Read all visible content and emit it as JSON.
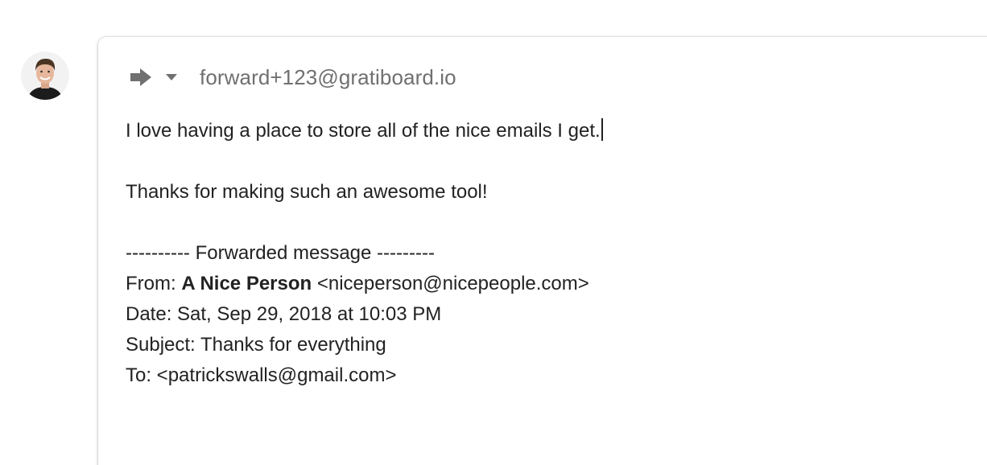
{
  "compose": {
    "recipient": "forward+123@gratiboard.io",
    "body": {
      "line1": "I love having a place to store all of the nice emails I get.",
      "line2": "Thanks for making such an awesome tool!",
      "forwarded_header": "---------- Forwarded message ---------",
      "from_label": "From:",
      "from_name": "A Nice Person",
      "from_email": "<niceperson@nicepeople.com>",
      "date_line": "Date: Sat, Sep 29, 2018 at 10:03 PM",
      "subject_line": "Subject: Thanks for everything",
      "to_line": "To: <patrickswalls@gmail.com>"
    }
  },
  "icons": {
    "forward": "forward-arrow-icon",
    "dropdown": "caret-down-icon",
    "avatar": "user-avatar"
  },
  "colors": {
    "icon_gray": "#707070",
    "text": "#222222"
  }
}
